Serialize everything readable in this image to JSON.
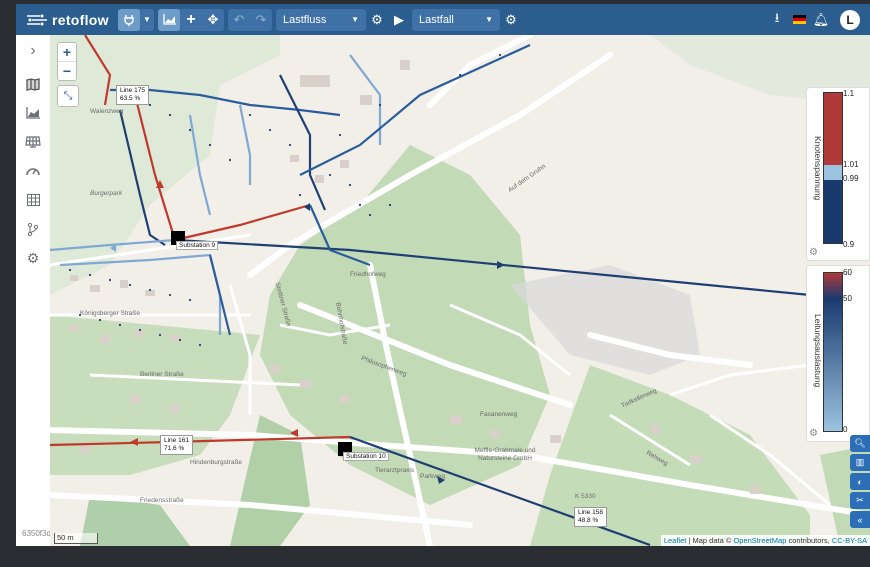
{
  "app": {
    "name": "retoflow"
  },
  "toolbar": {
    "plug_icon": "plug-icon",
    "analysis_select": "Lastfluss",
    "case_select": "Lastfall",
    "language_flag": "german-flag-icon",
    "user_initial": "L"
  },
  "map": {
    "zoom_in": "+",
    "zoom_out": "−",
    "scale": "50 m",
    "attribution": {
      "leaflet": "Leaflet",
      "separator": " | Map data © ",
      "osm": "OpenStreetMap",
      "contributors": " contributors, ",
      "license": "CC-BY-SA"
    },
    "version": "6350f3d",
    "substations": [
      {
        "label": "Substation 9"
      },
      {
        "label": "Substation 10"
      }
    ],
    "line_labels": [
      {
        "name": "Line 175",
        "value": "63.5 %"
      },
      {
        "name": "Line 161",
        "value": "71.6 %"
      },
      {
        "name": "Line 158",
        "value": "48.8 %"
      }
    ],
    "streets": [
      "Walenzweg",
      "Burgerpark",
      "Königsberger Straße",
      "Berliner Straße",
      "Stettiner Straße",
      "Bahnhofstraße",
      "Friedhofweg",
      "Philosophenweg",
      "Hindenburgstraße",
      "Friedensstraße",
      "Parkweg",
      "Tiefkellerweg",
      "Fasanenweg",
      "Auf dem Gruhn",
      "Tierarztpraxis",
      "Meffle-Grabmale und Natursteine GmbH",
      "Rehweg",
      "K 5330"
    ]
  },
  "legends": {
    "voltage": {
      "title": "Knotenspannung",
      "ticks": [
        "1.1",
        "1.01",
        "0.99",
        "0.9"
      ],
      "colors": [
        "#b03a3a",
        "#9cc3e0",
        "#1a3a6e"
      ]
    },
    "loading": {
      "title": "Leitungsauslastung",
      "ticks": [
        "60",
        "50",
        "0"
      ],
      "colors": [
        "#b03a3a",
        "#1a3a6e",
        "#9cc3e0"
      ]
    }
  },
  "colors": {
    "accent": "#2c5d8f",
    "overload": "#c0392b",
    "line_dark": "#1f3f73",
    "line_light": "#7fa8d4",
    "region_green": "#9cc79a"
  }
}
